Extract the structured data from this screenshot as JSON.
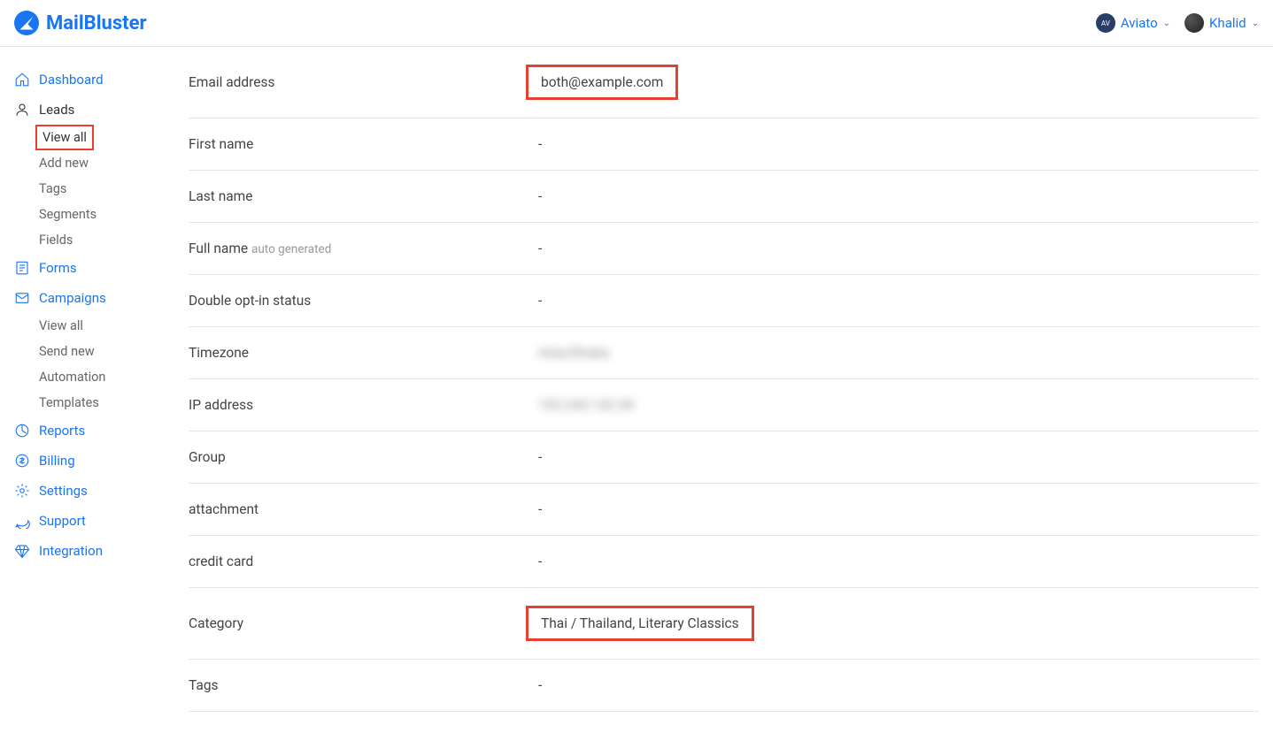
{
  "brand": "MailBluster",
  "header": {
    "org": "Aviato",
    "user": "Khalid"
  },
  "sidebar": {
    "dashboard": "Dashboard",
    "leads": {
      "label": "Leads",
      "items": [
        "View all",
        "Add new",
        "Tags",
        "Segments",
        "Fields"
      ]
    },
    "forms": "Forms",
    "campaigns": {
      "label": "Campaigns",
      "items": [
        "View all",
        "Send new",
        "Automation",
        "Templates"
      ]
    },
    "reports": "Reports",
    "billing": "Billing",
    "settings": "Settings",
    "support": "Support",
    "integration": "Integration"
  },
  "details": {
    "email": {
      "label": "Email address",
      "value": "both@example.com"
    },
    "first_name": {
      "label": "First name",
      "value": "-"
    },
    "last_name": {
      "label": "Last name",
      "value": "-"
    },
    "full_name": {
      "label": "Full name",
      "hint": "auto generated",
      "value": "-"
    },
    "double_opt_in": {
      "label": "Double opt-in status",
      "value": "-"
    },
    "timezone": {
      "label": "Timezone",
      "value": "Asia/Dhaka"
    },
    "ip": {
      "label": "IP address",
      "value": "103.244.142.54"
    },
    "group": {
      "label": "Group",
      "value": "-"
    },
    "attachment": {
      "label": "attachment",
      "value": "-"
    },
    "credit_card": {
      "label": "credit card",
      "value": "-"
    },
    "category": {
      "label": "Category",
      "value": "Thai / Thailand, Literary Classics"
    },
    "tags": {
      "label": "Tags",
      "value": "-"
    }
  }
}
